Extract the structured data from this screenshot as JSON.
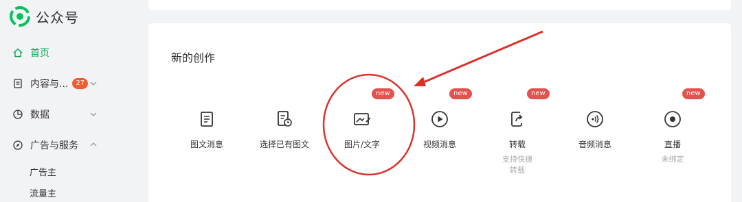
{
  "app": {
    "name": "公众号"
  },
  "sidebar": {
    "items": [
      {
        "label": "首页",
        "active": true,
        "icon": "home-icon"
      },
      {
        "label": "内容与...",
        "badge": "27",
        "icon": "document-icon"
      },
      {
        "label": "数据",
        "icon": "chart-pie-icon"
      },
      {
        "label": "广告与服务",
        "icon": "compass-icon"
      }
    ],
    "sub_items": [
      "广告主",
      "流量主"
    ]
  },
  "main": {
    "section_title": "新的创作",
    "tools": [
      {
        "label": "图文消息",
        "icon": "article-icon",
        "new": false
      },
      {
        "label": "选择已有图文",
        "icon": "existing-article-icon",
        "new": false
      },
      {
        "label": "图片/文字",
        "icon": "image-text-icon",
        "new": true
      },
      {
        "label": "视频消息",
        "icon": "video-play-icon",
        "new": true
      },
      {
        "label": "转载",
        "sub": "支持快捷转载",
        "icon": "repost-icon",
        "new": true
      },
      {
        "label": "音频消息",
        "icon": "audio-icon",
        "new": false
      },
      {
        "label": "直播",
        "sub": "未绑定",
        "icon": "live-icon",
        "new": true
      }
    ],
    "new_tag": "new"
  },
  "colors": {
    "accent": "#07a85b",
    "badge": "#f45a30",
    "new_tag": "#e2524e",
    "annotation": "#d9322b"
  }
}
